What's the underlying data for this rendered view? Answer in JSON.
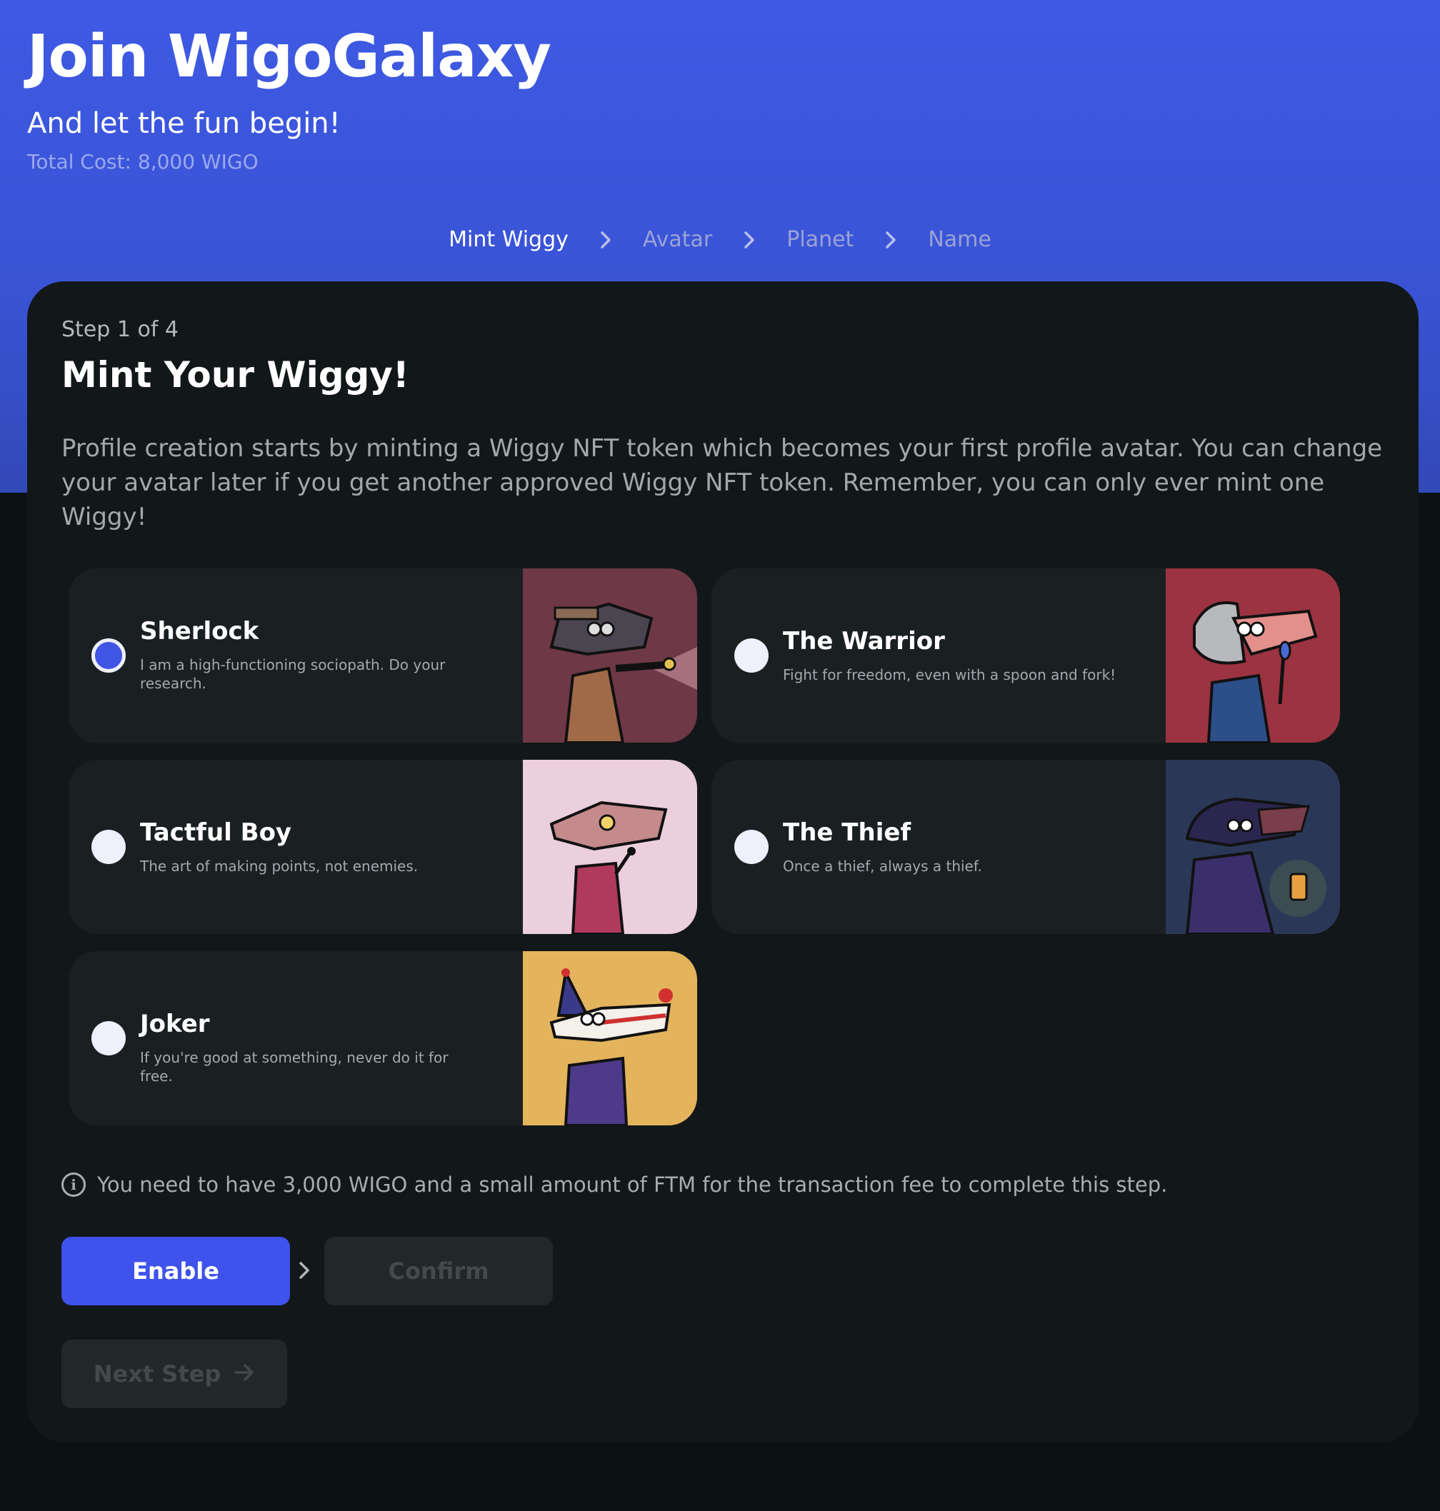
{
  "hero": {
    "title": "Join WigoGalaxy",
    "subtitle": "And let the fun begin!",
    "total_cost": "Total Cost: 8,000 WIGO"
  },
  "breadcrumb": [
    "Mint Wiggy",
    "Avatar",
    "Planet",
    "Name"
  ],
  "breadcrumb_active": "Mint Wiggy",
  "card": {
    "step": "Step 1 of 4",
    "title": "Mint Your Wiggy!",
    "description": "Profile creation starts by minting a Wiggy NFT token which becomes your first profile avatar. You can change your avatar later if you get another approved Wiggy NFT token. Remember, you can only ever mint one Wiggy!"
  },
  "options": [
    {
      "name": "Sherlock",
      "desc": "I am a high-functioning sociopath. Do your research.",
      "selected": true,
      "bg": "#6e3846",
      "icon": "sherlock-avatar"
    },
    {
      "name": "The Warrior",
      "desc": "Fight for freedom, even with a spoon and fork!",
      "selected": false,
      "bg": "#9c3340",
      "icon": "warrior-avatar"
    },
    {
      "name": "Tactful Boy",
      "desc": "The art of making points, not enemies.",
      "selected": false,
      "bg": "#eccfdc",
      "icon": "tactful-boy-avatar"
    },
    {
      "name": "The Thief",
      "desc": "Once a thief, always a thief.",
      "selected": false,
      "bg": "#2b3757",
      "icon": "thief-avatar"
    },
    {
      "name": "Joker",
      "desc": "If you're good at something, never do it for free.",
      "selected": false,
      "bg": "#e3b45c",
      "icon": "joker-avatar"
    }
  ],
  "info": "You need to have 3,000 WIGO and a small amount of FTM for the transaction fee to complete this step.",
  "buttons": {
    "enable": "Enable",
    "confirm": "Confirm",
    "next": "Next Step"
  },
  "colors": {
    "accent": "#3f52ec",
    "hero_top": "#3e5ae3",
    "background": "#0c1113",
    "card": "#121719"
  }
}
